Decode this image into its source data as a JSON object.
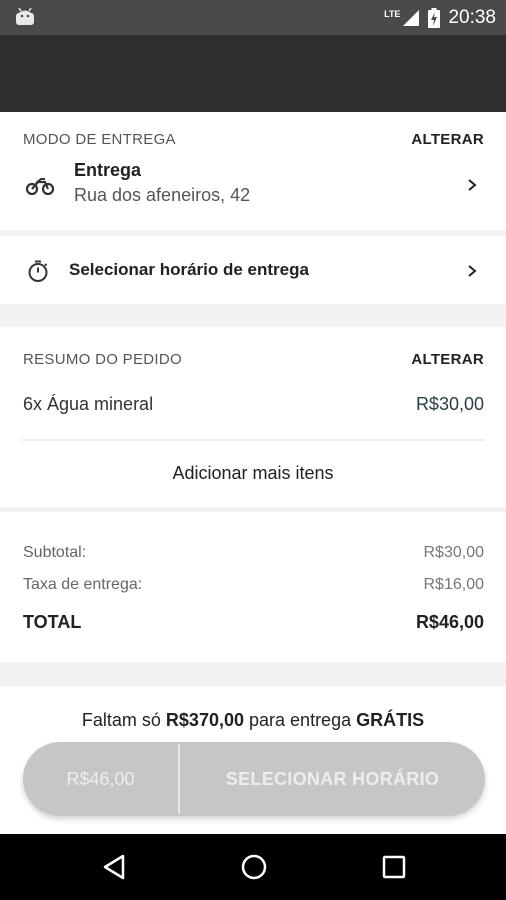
{
  "status_bar": {
    "network": "LTE",
    "time": "20:38",
    "icons": [
      "android-icon",
      "signal-icon",
      "battery-charging-icon"
    ]
  },
  "delivery": {
    "header": "MODO DE ENTREGA",
    "change_label": "ALTERAR",
    "icon": "motorcycle-icon",
    "title": "Entrega",
    "address": "Rua dos afeneiros, 42"
  },
  "schedule": {
    "icon": "timer-icon",
    "label": "Selecionar horário de entrega"
  },
  "summary": {
    "header": "RESUMO DO PEDIDO",
    "change_label": "ALTERAR",
    "items": [
      {
        "name": "6x Água mineral",
        "price": "R$30,00"
      }
    ],
    "add_more": "Adicionar mais itens"
  },
  "totals": {
    "subtotal_label": "Subtotal:",
    "subtotal_value": "R$30,00",
    "fee_label": "Taxa de entrega:",
    "fee_value": "R$16,00",
    "total_label": "TOTAL",
    "total_value": "R$46,00"
  },
  "footer": {
    "free_prefix": "Faltam só",
    "free_amount": "R$370,00",
    "free_middle": "para entrega",
    "free_word": "GRÁTIS",
    "button_price": "R$46,00",
    "button_action": "SELECIONAR HORÁRIO"
  },
  "nav": {
    "icons": [
      "back-icon",
      "home-icon",
      "recents-icon"
    ]
  },
  "colors": {
    "app_bar": "#2f2f2f",
    "status_bar": "#4a4a4a",
    "button_disabled": "#c6c6c6",
    "price_text": "#2a3f44"
  }
}
